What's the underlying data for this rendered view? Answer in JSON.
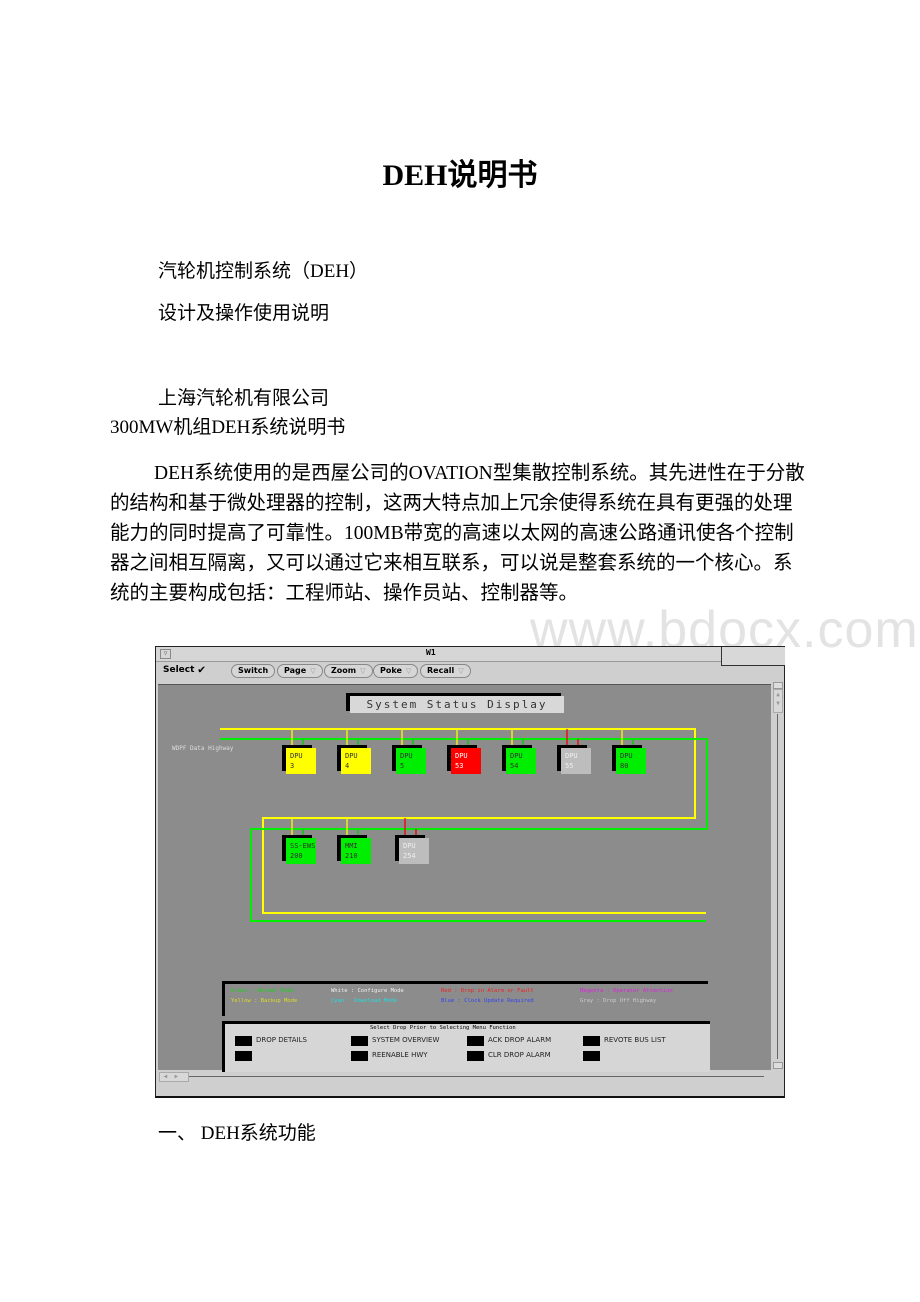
{
  "document": {
    "title": "DEH说明书",
    "subtitle_lines": [
      "汽轮机控制系统（DEH）",
      "设计及操作使用说明"
    ],
    "company": "上海汽轮机有限公司",
    "manual_name": "300MW机组DEH系统说明书",
    "paragraph": "DEH系统使用的是西屋公司的OVATION型集散控制系统。其先进性在于分散的结构和基于微处理器的控制，这两大特点加上冗余使得系统在具有更强的处理能力的同时提高了可靠性。100MB带宽的高速以太网的高速公路通讯使各个控制器之间相互隔离，又可以通过它来相互联系，可以说是整套系统的一个核心。系统的主要构成包括：工程师站、操作员站、控制器等。",
    "section_heading": "一、 DEH系统功能",
    "watermark": "www.bdocx.com"
  },
  "window": {
    "title": "W1",
    "select_label": "Select",
    "toolbar": [
      {
        "label": "Switch",
        "dropdown": false
      },
      {
        "label": "Page",
        "dropdown": true
      },
      {
        "label": "Zoom",
        "dropdown": true
      },
      {
        "label": "Poke",
        "dropdown": true
      },
      {
        "label": "Recall",
        "dropdown": true
      }
    ],
    "display_title": "System Status Display",
    "highway_label": "WDPF Data Highway",
    "drops_row1": [
      {
        "name": "DPU",
        "id": "3",
        "status": "yellow"
      },
      {
        "name": "DPU",
        "id": "4",
        "status": "yellow"
      },
      {
        "name": "DPU",
        "id": "5",
        "status": "green"
      },
      {
        "name": "DPU",
        "id": "53",
        "status": "red"
      },
      {
        "name": "DPU",
        "id": "54",
        "status": "green"
      },
      {
        "name": "DPU",
        "id": "55",
        "status": "gray"
      },
      {
        "name": "DPU",
        "id": "80",
        "status": "green"
      }
    ],
    "drops_row2": [
      {
        "name": "SS-EWS",
        "id": "200",
        "status": "green"
      },
      {
        "name": "MMI",
        "id": "210",
        "status": "green"
      },
      {
        "name": "DPU",
        "id": "254",
        "status": "gray"
      }
    ],
    "legend": [
      {
        "text": "Green  : Normal Mode",
        "color": "#22cc22"
      },
      {
        "text": "White  : Configure Mode",
        "color": "#f0f0f0"
      },
      {
        "text": "Red    : Drop in Alarm or Fault",
        "color": "#ee2222"
      },
      {
        "text": "Magenta : Operator Attention",
        "color": "#dd22dd"
      },
      {
        "text": "Yellow : Backup Mode",
        "color": "#dddd22"
      },
      {
        "text": "Cyan   : Download Mode",
        "color": "#22dddd"
      },
      {
        "text": "Blue   : Clock Update Required",
        "color": "#3344ee"
      },
      {
        "text": "Gray   : Drop Off Highway",
        "color": "#cccccc"
      }
    ],
    "menu_header": "Select Drop Prior to Selecting Menu Function",
    "menu_items": [
      "DROP DETAILS",
      "SYSTEM OVERVIEW",
      "ACK DROP ALARM",
      "REVOTE BUS LIST",
      "",
      "REENABLE HWY",
      "CLR DROP ALARM",
      ""
    ],
    "colors": {
      "yellow": "#ffff00",
      "green": "#00ee00",
      "red": "#ff0000",
      "gray": "#bdbdbd",
      "canvas": "#8c8c8c"
    }
  }
}
